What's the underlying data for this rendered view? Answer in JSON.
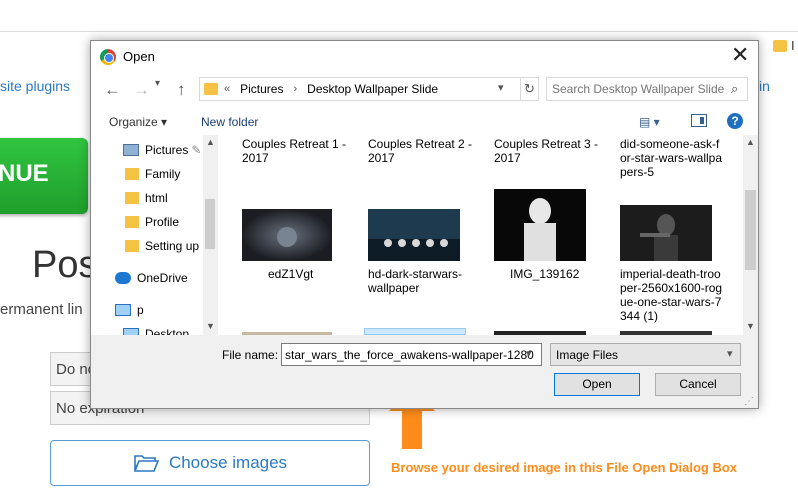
{
  "background": {
    "site_plugins": "site plugins",
    "signin_partial": "in",
    "green_button": "NUE",
    "heading_partial": "Pos",
    "permanent_partial": "ermanent lin",
    "select1": "Do no",
    "select2": "No expiration",
    "choose_images": "Choose images",
    "bookmark_letter": "I"
  },
  "caption": "Browse your desired image in this File Open Dialog Box",
  "dialog": {
    "title": "Open",
    "close": "✕",
    "nav": {
      "back": "←",
      "forward": "→",
      "up": "↑"
    },
    "address": {
      "prefix": "«",
      "segments": [
        "Pictures",
        "Desktop Wallpaper Slide"
      ]
    },
    "search_placeholder": "Search Desktop Wallpaper Slide",
    "toolbar": {
      "organize": "Organize ▾",
      "new_folder": "New folder",
      "help": "?"
    },
    "nav_pane": [
      "Pictures",
      "Family",
      "html",
      "Profile",
      "Setting up",
      "OneDrive",
      "p",
      "Desktop"
    ],
    "files_top": [
      "Couples Retreat 1 - 2017",
      "Couples Retreat 2 - 2017",
      "Couples Retreat 3 - 2017",
      "did-someone-ask-for-star-wars-wallpapers-5"
    ],
    "files_bottom": [
      "edZ1Vgt",
      "hd-dark-starwars-wallpaper",
      "IMG_139162",
      "imperial-death-trooper-2560x1600-rogue-one-star-wars-7344 (1)"
    ],
    "file_name_label": "File name:",
    "file_name_value": "star_wars_the_force_awakens-wallpaper-1280",
    "file_type": "Image Files",
    "open_button": "Open",
    "cancel_button": "Cancel"
  },
  "colors": {
    "accent": "#0078d7",
    "folder": "#f6c244",
    "caption": "#ff8c1a",
    "link": "#2a79c4"
  }
}
